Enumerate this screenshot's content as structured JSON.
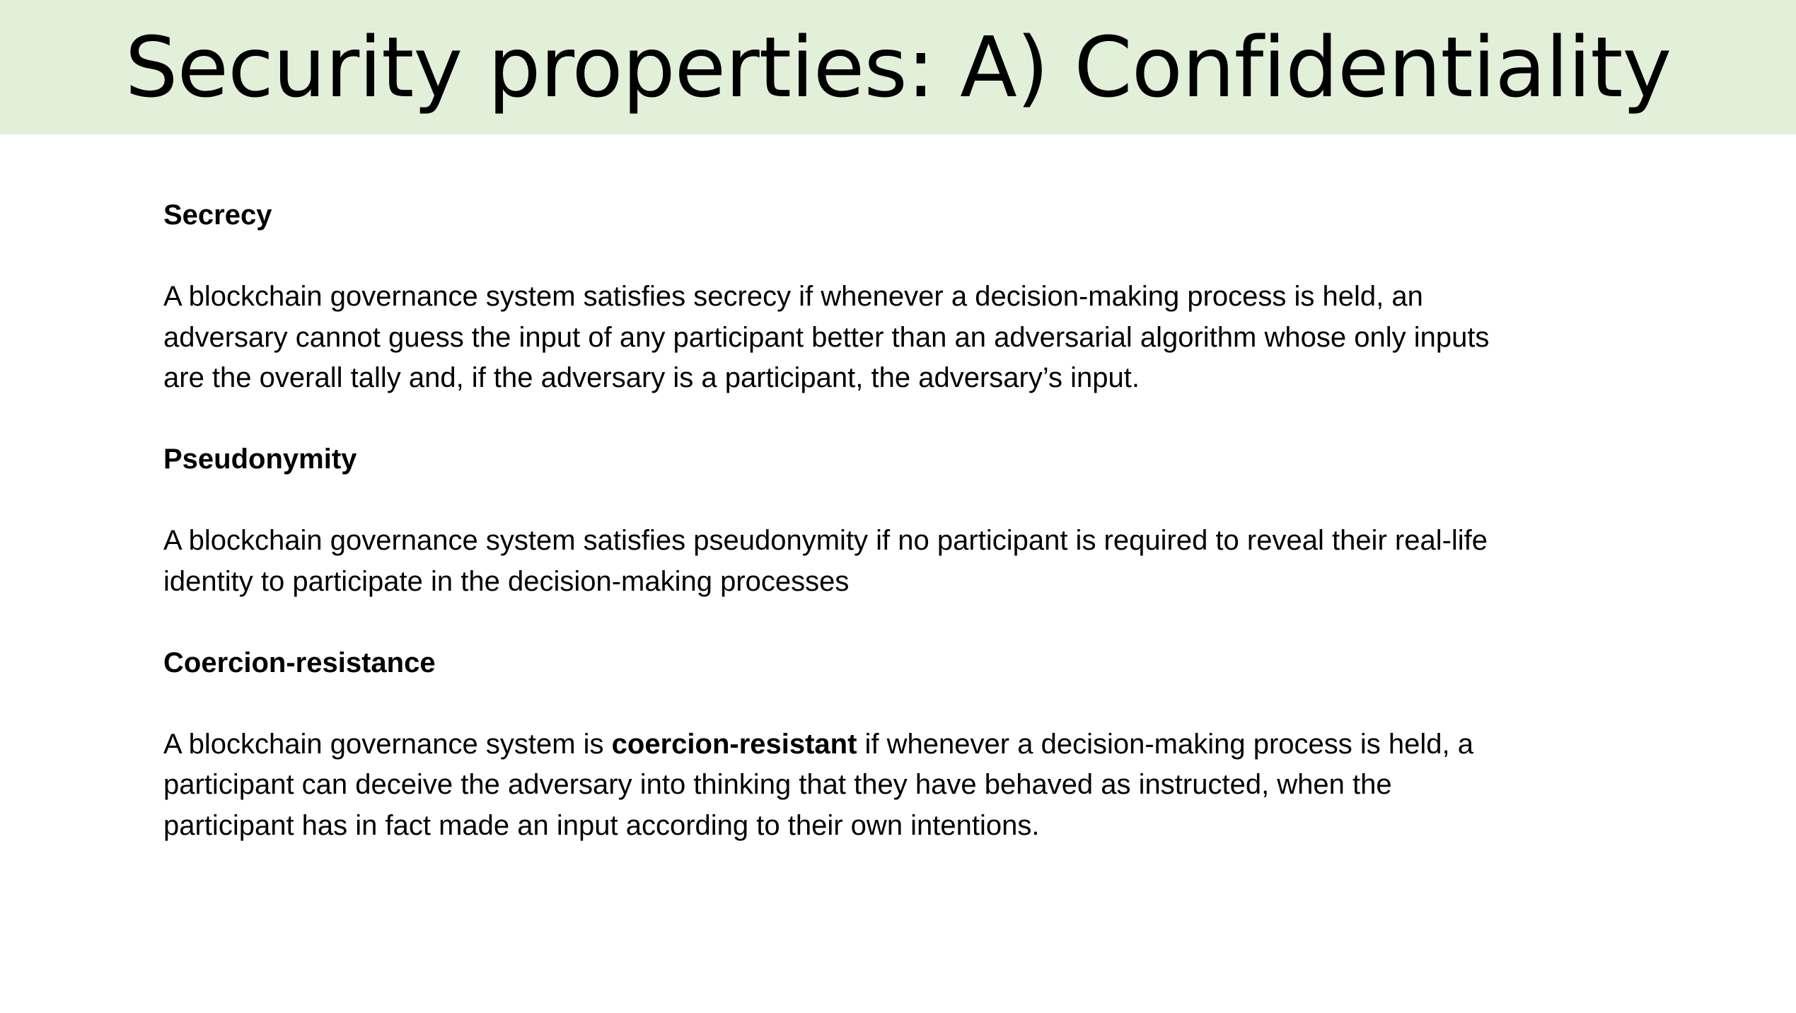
{
  "slide": {
    "title": "Security properties: A) Confidentiality",
    "sections": [
      {
        "heading": "Secrecy",
        "lines": [
          "A blockchain governance system satisfies secrecy if whenever a decision-making process is held, an",
          "adversary cannot guess the input of any participant better than an adversarial algorithm whose only inputs",
          "are the overall tally and, if the adversary is a participant, the adversary’s input."
        ]
      },
      {
        "heading": "Pseudonymity",
        "lines": [
          "A blockchain governance system satisfies pseudonymity if no participant is required to reveal their real-life",
          "identity to participate in the decision-making processes"
        ]
      },
      {
        "heading": "Coercion-resistance",
        "line1_before": "A blockchain governance system is ",
        "line1_bold": "coercion-resistant",
        "line1_after": " if whenever a decision-making process is held, a",
        "lines": [
          "participant can deceive the adversary into thinking that they have behaved as instructed, when the",
          "participant has in fact made an input according to their own intentions."
        ]
      }
    ]
  },
  "colors": {
    "title_bar_background": "#e2efd9",
    "text": "#000000",
    "background": "#ffffff"
  }
}
